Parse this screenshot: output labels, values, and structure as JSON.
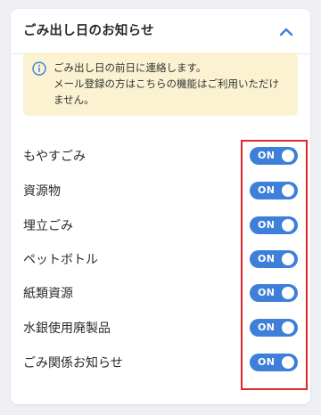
{
  "panel": {
    "title": "ごみ出し日のお知らせ",
    "collapse_icon": "chevron-up-icon",
    "collapse_color": "#3e7fd9"
  },
  "notice": {
    "icon": "info-icon",
    "lines": [
      "ごみ出し日の前日に連絡します。",
      "メール登録の方はこちらの機能はご利用いただけ",
      "ません。"
    ],
    "background": "#fbf2d2"
  },
  "settings": [
    {
      "label": "もやすごみ",
      "toggle": "ON"
    },
    {
      "label": "資源物",
      "toggle": "ON"
    },
    {
      "label": "埋立ごみ",
      "toggle": "ON"
    },
    {
      "label": "ペットボトル",
      "toggle": "ON"
    },
    {
      "label": "紙類資源",
      "toggle": "ON"
    },
    {
      "label": "水銀使用廃製品",
      "toggle": "ON"
    },
    {
      "label": "ごみ関係お知らせ",
      "toggle": "ON"
    }
  ],
  "colors": {
    "toggle_on": "#3e7fd9",
    "highlight": "#e0262b"
  }
}
